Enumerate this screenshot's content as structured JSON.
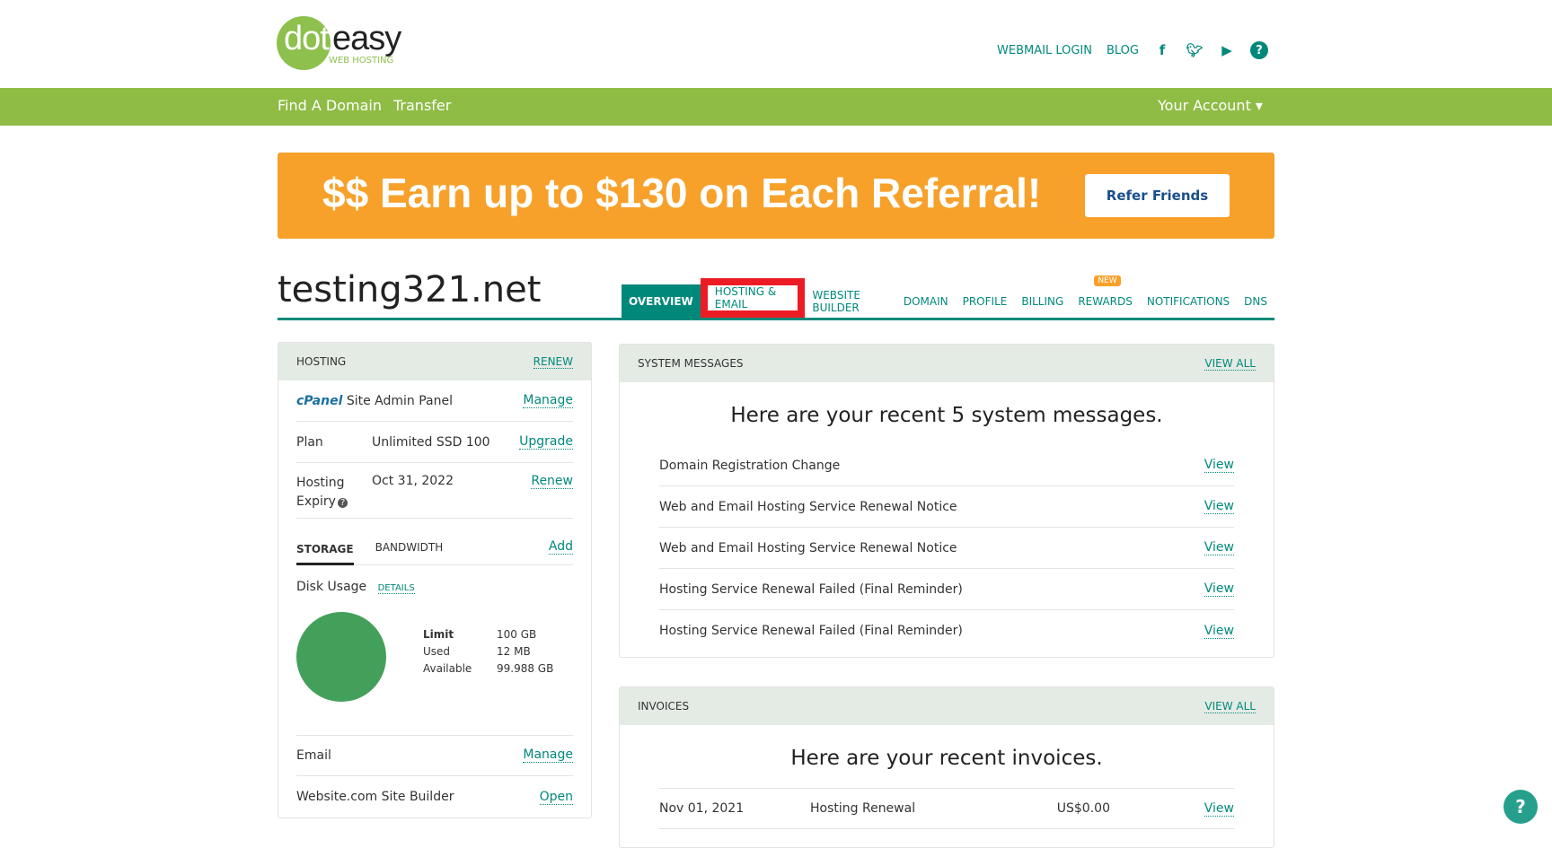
{
  "logo": {
    "dot": "dot",
    "easy": "easy",
    "sub": "WEB HOSTING"
  },
  "toplinks": {
    "webmail": "WEBMAIL LOGIN",
    "blog": "BLOG"
  },
  "nav": {
    "find": "Find A Domain",
    "transfer": "Transfer",
    "account": "Your Account ▾"
  },
  "banner": {
    "text": "$$ Earn up to $130 on Each Referral!",
    "button": "Refer Friends"
  },
  "domain": "testing321.net",
  "tabs": [
    "OVERVIEW",
    "HOSTING & EMAIL",
    "WEBSITE BUILDER",
    "DOMAIN",
    "PROFILE",
    "BILLING",
    "REWARDS",
    "NOTIFICATIONS",
    "DNS"
  ],
  "new_badge": "NEW",
  "hosting": {
    "title": "HOSTING",
    "renew": "RENEW",
    "cpanel": "cPanel",
    "admin": "Site Admin Panel",
    "manage": "Manage",
    "plan_label": "Plan",
    "plan": "Unlimited SSD 100",
    "upgrade": "Upgrade",
    "expiry_label1": "Hosting",
    "expiry_label2": "Expiry",
    "expiry": "Oct 31, 2022",
    "renew2": "Renew",
    "storage": "STORAGE",
    "bandwidth": "BANDWIDTH",
    "add": "Add",
    "disk": "Disk Usage",
    "details": "DETAILS",
    "limit_l": "Limit",
    "limit": "100 GB",
    "used_l": "Used",
    "used": "12 MB",
    "avail_l": "Available",
    "avail": "99.988 GB",
    "used_fraction": 0.00012,
    "email": "Email",
    "email_manage": "Manage",
    "builder": "Website.com Site Builder",
    "open": "Open"
  },
  "messages": {
    "title": "SYSTEM MESSAGES",
    "view_all": "VIEW ALL",
    "intro": "Here are your recent 5 system messages.",
    "items": [
      "Domain Registration Change",
      "Web and Email Hosting Service Renewal Notice",
      "Web and Email Hosting Service Renewal Notice",
      "Hosting Service Renewal Failed (Final Reminder)",
      "Hosting Service Renewal Failed (Final Reminder)"
    ],
    "view": "View"
  },
  "invoices": {
    "title": "INVOICES",
    "view_all": "VIEW ALL",
    "intro": "Here are your recent invoices.",
    "items": [
      {
        "date": "Nov 01, 2021",
        "desc": "Hosting Renewal",
        "amount": "US$0.00",
        "view": "View"
      }
    ]
  },
  "colors": {
    "green": "#8fbc45",
    "teal": "#00897b",
    "orange": "#f7a12b",
    "highlight": "#ed1c24"
  }
}
